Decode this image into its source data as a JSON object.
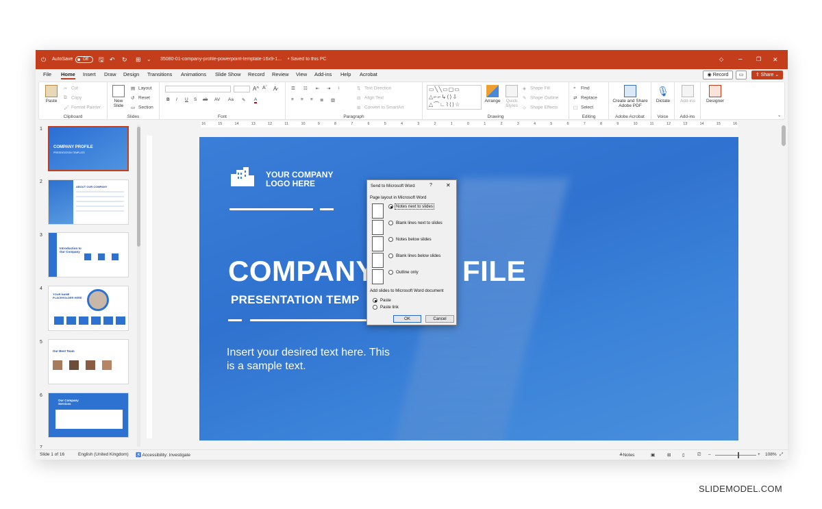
{
  "titlebar": {
    "autosave_label": "AutoSave",
    "autosave_state": "Off",
    "doc_title": "35080-01-company-profile-powerpoint-template-16x9-1...",
    "saved_status": "Saved to this PC",
    "bg_color": "#c43e1c"
  },
  "menu": {
    "tabs": [
      "File",
      "Home",
      "Insert",
      "Draw",
      "Design",
      "Transitions",
      "Animations",
      "Slide Show",
      "Record",
      "Review",
      "View",
      "Add-ins",
      "Help",
      "Acrobat"
    ],
    "active_tab": "Home",
    "record_label": "Record",
    "share_label": "Share"
  },
  "ribbon": {
    "clipboard": {
      "paste": "Paste",
      "cut": "Cut",
      "copy": "Copy",
      "format_painter": "Format Painter",
      "label": "Clipboard"
    },
    "slides": {
      "new_slide": "New Slide",
      "layout": "Layout",
      "reset": "Reset",
      "section": "Section",
      "label": "Slides"
    },
    "font": {
      "label": "Font"
    },
    "paragraph": {
      "text_direction": "Text Direction",
      "align_text": "Align Text",
      "convert_smartart": "Convert to SmartArt",
      "label": "Paragraph"
    },
    "drawing": {
      "arrange": "Arrange",
      "quick_styles": "Quick Styles",
      "shape_fill": "Shape Fill",
      "shape_outline": "Shape Outline",
      "shape_effects": "Shape Effects",
      "label": "Drawing"
    },
    "editing": {
      "find": "Find",
      "replace": "Replace",
      "select": "Select",
      "label": "Editing"
    },
    "acrobat": {
      "create_share": "Create and Share Adobe PDF",
      "label": "Adobe Acrobat"
    },
    "voice": {
      "dictate": "Dictate",
      "label": "Voice"
    },
    "addins": {
      "addins": "Add-ins",
      "label": "Add-ins"
    },
    "designer": {
      "designer": "Designer"
    }
  },
  "thumbnails": [
    {
      "num": "1",
      "title": "COMPANY PROFILE",
      "subtitle": "PRESENTATION TEMPLATE"
    },
    {
      "num": "2",
      "title": "ABOUT OUR COMPANY"
    },
    {
      "num": "3",
      "title": "Introduction to Our Company"
    },
    {
      "num": "4",
      "title": "YOUR NAME PLACEHOLDER HERE"
    },
    {
      "num": "5",
      "title": "Our Best Team"
    },
    {
      "num": "6",
      "title": "Our Company Services"
    },
    {
      "num": "7",
      "title": ""
    }
  ],
  "ruler": {
    "ticks": [
      "16",
      "15",
      "14",
      "13",
      "12",
      "11",
      "10",
      "9",
      "8",
      "7",
      "6",
      "5",
      "4",
      "3",
      "2",
      "1",
      "0",
      "1",
      "2",
      "3",
      "4",
      "5",
      "6",
      "7",
      "8",
      "9",
      "10",
      "11",
      "12",
      "13",
      "14",
      "15",
      "16"
    ]
  },
  "slide": {
    "logo_line1": "YOUR COMPANY",
    "logo_line2": "LOGO HERE",
    "title_left": "COMPANY",
    "title_right": "FILE",
    "subtitle": "PRESENTATION TEMP",
    "body_line1": "Insert your desired text here. This",
    "body_line2": "is a sample text."
  },
  "dialog": {
    "title": "Send to Microsoft Word",
    "help": "?",
    "close": "✕",
    "section1": "Page layout in Microsoft Word",
    "options": [
      {
        "label": "Notes next to slides",
        "selected": true
      },
      {
        "label": "Blank lines next to slides",
        "selected": false
      },
      {
        "label": "Notes below slides",
        "selected": false
      },
      {
        "label": "Blank lines below slides",
        "selected": false
      },
      {
        "label": "Outline only",
        "selected": false
      }
    ],
    "section2": "Add slides to Microsoft Word document",
    "paste_options": [
      {
        "label": "Paste",
        "selected": true
      },
      {
        "label": "Paste link",
        "selected": false
      }
    ],
    "ok": "OK",
    "cancel": "Cancel"
  },
  "status": {
    "slide_count": "Slide 1 of 16",
    "language": "English (United Kingdom)",
    "accessibility": "Accessibility: Investigate",
    "notes": "Notes",
    "zoom": "108%",
    "zoom_level": 0.55
  },
  "watermark": "SLIDEMODEL.COM"
}
